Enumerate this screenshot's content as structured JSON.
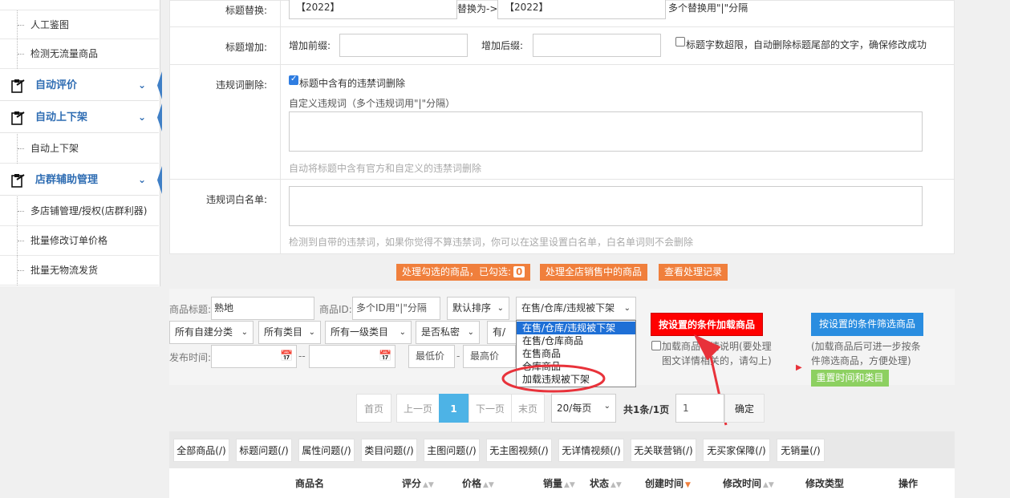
{
  "sidebar": {
    "items": [
      {
        "label": "人工鉴图",
        "type": "sub"
      },
      {
        "label": "检测无流量商品",
        "type": "sub"
      },
      {
        "label": "自动评价",
        "type": "head"
      },
      {
        "label": "自动上下架",
        "type": "head"
      },
      {
        "label": "自动上下架",
        "type": "sub"
      },
      {
        "label": "店群辅助管理",
        "type": "head"
      },
      {
        "label": "多店铺管理/授权(店群利器)",
        "type": "sub"
      },
      {
        "label": "批量修改订单价格",
        "type": "sub"
      },
      {
        "label": "批量无物流发货",
        "type": "sub"
      }
    ]
  },
  "form": {
    "replace_label": "标题替换:",
    "replace_from": "【2022】",
    "replace_arrow": "替换为->",
    "replace_to": "【2022】",
    "replace_hint": "多个替换用\"|\"分隔",
    "add_label": "标题增加:",
    "prefix_label": "增加前缀:",
    "suffix_label": "增加后缀:",
    "overflow_label": "标题字数超限，自动删除标题尾部的文字，确保修改成功",
    "delete_label": "违规词删除:",
    "delete_check": "标题中含有的违禁词删除",
    "custom_words_label": "自定义违规词（多个违规词用\"|\"分隔）",
    "delete_hint": "自动将标题中含有官方和自定义的违禁词删除",
    "whitelist_label": "违规词白名单:",
    "whitelist_hint": "检测到自带的违禁词，如果你觉得不算违禁词，你可以在这里设置白名单，白名单词则不会删除"
  },
  "actions": {
    "process_selected": "处理勾选的商品，已勾选:",
    "selected_count": "0",
    "process_all": "处理全店销售中的商品",
    "view_log": "查看处理记录"
  },
  "filter": {
    "title_label": "商品标题:",
    "title_value": "熟地",
    "id_label": "商品ID:",
    "id_placeholder": "多个ID用\"|\"分隔",
    "sort": "默认排序",
    "status": "在售/仓库/违规被下架",
    "status_options": [
      "在售/仓库/违规被下架",
      "在售/仓库商品",
      "在售商品",
      "仓库商品",
      "加载违规被下架"
    ],
    "self_category": "所有自建分类",
    "category": "所有类目",
    "level1": "所有一级类目",
    "private": "是否私密",
    "has_none": "有/无",
    "publish_label": "发布时间:",
    "dash": "--",
    "min_price": "最低价",
    "dash2": "-",
    "max_price": "最高价",
    "load_button": "按设置的条件加载商品",
    "filter_button": "按设置的条件筛选商品",
    "load_detail": "加载商品详情说明(要处理图文详情相关的，请勾上)",
    "filter_note": "(加载商品后可进一步按条件筛选商品，方便处理)",
    "reset_button": "重置时间和类目"
  },
  "pagination": {
    "first": "首页",
    "prev": "上一页",
    "current": "1",
    "next": "下一页",
    "last": "末页",
    "per_page": "20/每页",
    "summary": "共1条/1页",
    "goto_value": "1",
    "confirm": "确定"
  },
  "tabs": [
    "全部商品(/)",
    "标题问题(/)",
    "属性问题(/)",
    "类目问题(/)",
    "主图问题(/)",
    "无主图视频(/)",
    "无详情视频(/)",
    "无关联营销(/)",
    "无买家保障(/)",
    "无销量(/)"
  ],
  "table": {
    "headers": [
      "商品名",
      "评分",
      "价格",
      "销量",
      "状态",
      "创建时间",
      "修改时间",
      "修改类型",
      "操作"
    ]
  },
  "colors": {
    "accent": "#2f6db3",
    "orange": "#f07f3c",
    "red": "#ff0000",
    "blue": "#2a8de0",
    "green": "#8dd061",
    "annotation": "#e8323a"
  }
}
